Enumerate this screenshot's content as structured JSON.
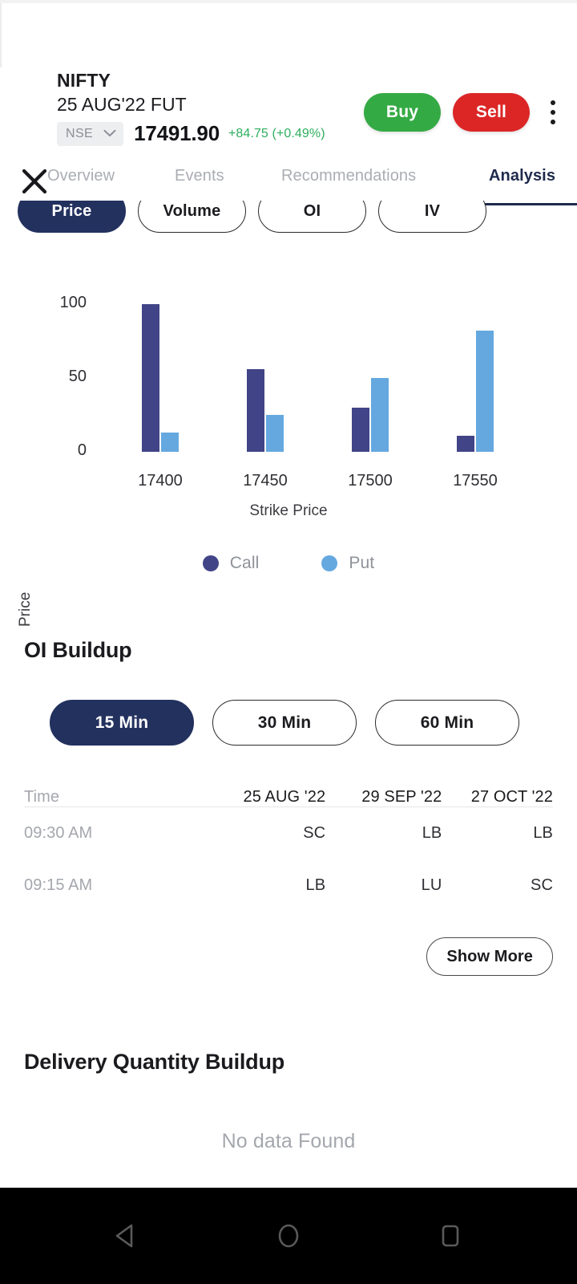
{
  "header": {
    "close_icon": "close-icon",
    "symbol": "NIFTY",
    "expiry": "25 AUG'22 FUT",
    "exchange": "NSE",
    "exchange_chevron_icon": "chevron-down-icon",
    "ltp": "17491.90",
    "change": "+84.75 (+0.49%)",
    "change_color": "#2eae5e",
    "buy_label": "Buy",
    "sell_label": "Sell",
    "buy_color": "#34aa44",
    "sell_color": "#dc2626",
    "more_icon": "kebab-menu-icon"
  },
  "tabs": [
    {
      "label": "Overview",
      "active": false
    },
    {
      "label": "Events",
      "active": false
    },
    {
      "label": "Recommendations",
      "active": false
    },
    {
      "label": "Analysis",
      "active": true
    }
  ],
  "metric_chips": [
    {
      "label": "Price",
      "selected": true
    },
    {
      "label": "Volume",
      "selected": false
    },
    {
      "label": "OI",
      "selected": false
    },
    {
      "label": "IV",
      "selected": false
    }
  ],
  "chart_data": {
    "type": "bar",
    "title": "",
    "xlabel": "Strike Price",
    "ylabel": "Price",
    "categories": [
      "17400",
      "17450",
      "17500",
      "17550"
    ],
    "yticks": [
      0,
      50,
      100
    ],
    "ylim": [
      0,
      110
    ],
    "grid": false,
    "legend_position": "bottom",
    "series": [
      {
        "name": "Call",
        "color": "#414487",
        "values": [
          100,
          56,
          30,
          11
        ]
      },
      {
        "name": "Put",
        "color": "#65a8e0",
        "values": [
          13,
          25,
          50,
          82
        ]
      }
    ]
  },
  "oi_buildup": {
    "title": "OI Buildup",
    "timeframes": [
      {
        "label": "15 Min",
        "selected": true
      },
      {
        "label": "30 Min",
        "selected": false
      },
      {
        "label": "60 Min",
        "selected": false
      }
    ],
    "columns": [
      "Time",
      "25 AUG '22",
      "29 SEP '22",
      "27 OCT '22"
    ],
    "rows": [
      {
        "time": "09:30 AM",
        "values": [
          "SC",
          "LB",
          "LB"
        ]
      },
      {
        "time": "09:15 AM",
        "values": [
          "LB",
          "LU",
          "SC"
        ]
      }
    ],
    "show_more_label": "Show More"
  },
  "delivery_buildup": {
    "title": "Delivery Quantity Buildup",
    "empty_message": "No data Found"
  },
  "navbar": {
    "back_icon": "triangle-back-icon",
    "home_icon": "circle-home-icon",
    "recents_icon": "square-recents-icon"
  }
}
